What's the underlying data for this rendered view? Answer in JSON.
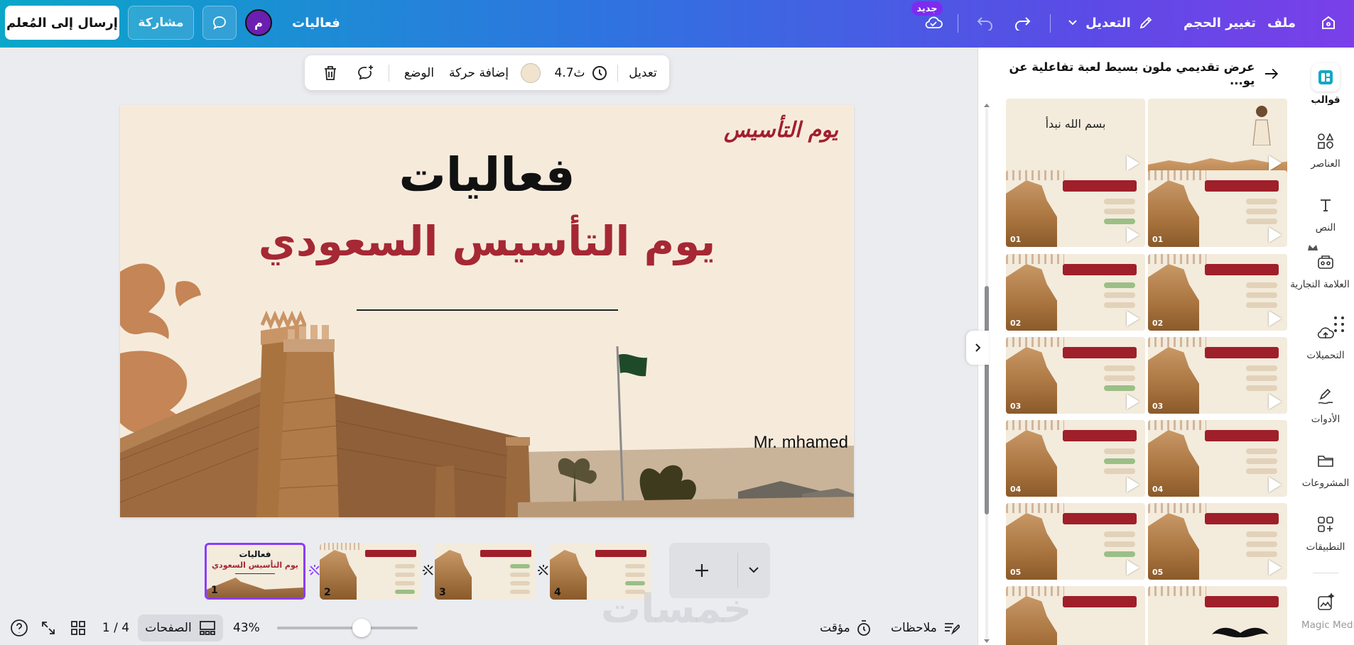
{
  "topbar": {
    "send_to_teacher": "إرسال إلى المُعلم",
    "share": "مشاركة",
    "avatar_initial": "م",
    "doc_title": "فعاليات",
    "new_badge": "جديد",
    "edit_menu": "التعديل",
    "resize": "تغيير الحجم",
    "file": "ملف"
  },
  "toolbar": {
    "edit": "تعديل",
    "duration": "4.7ث",
    "add_animation": "إضافة حركة",
    "position": "الوضع"
  },
  "slide": {
    "logo": "يوم التأسيس",
    "title": "فعاليات",
    "subtitle": "يوم التأسيس السعودي",
    "author": "Mr. mhamed"
  },
  "panel": {
    "title": "عرض تقديمي ملون بسيط لعبة تفاعلية عن يو...",
    "first_thumb_text": "بسم الله نبدأ",
    "thumb_numbers": [
      "01",
      "02",
      "03",
      "04",
      "05"
    ]
  },
  "rail": {
    "templates": "قوالب",
    "elements": "العناصر",
    "text": "النص",
    "brand": "العلامة التجارية",
    "uploads": "التحميلات",
    "tools": "الأدوات",
    "projects": "المشروعات",
    "apps": "التطبيقات",
    "magic": "Magic Media"
  },
  "pages": {
    "thumb1_title": "فعاليات",
    "thumb1_subtitle": "يوم التأسيس السعودي",
    "numbers": [
      "1",
      "2",
      "3",
      "4"
    ]
  },
  "bottom": {
    "notes": "ملاحظات",
    "timer": "مؤقت",
    "zoom": "43%",
    "pages": "الصفحات",
    "page_count": "1 / 4",
    "help": "?"
  },
  "watermark": "خمسات",
  "colors": {
    "accent": "#8b3dff",
    "slide_red": "#a52834",
    "slide_bg": "#f6ebdb"
  }
}
